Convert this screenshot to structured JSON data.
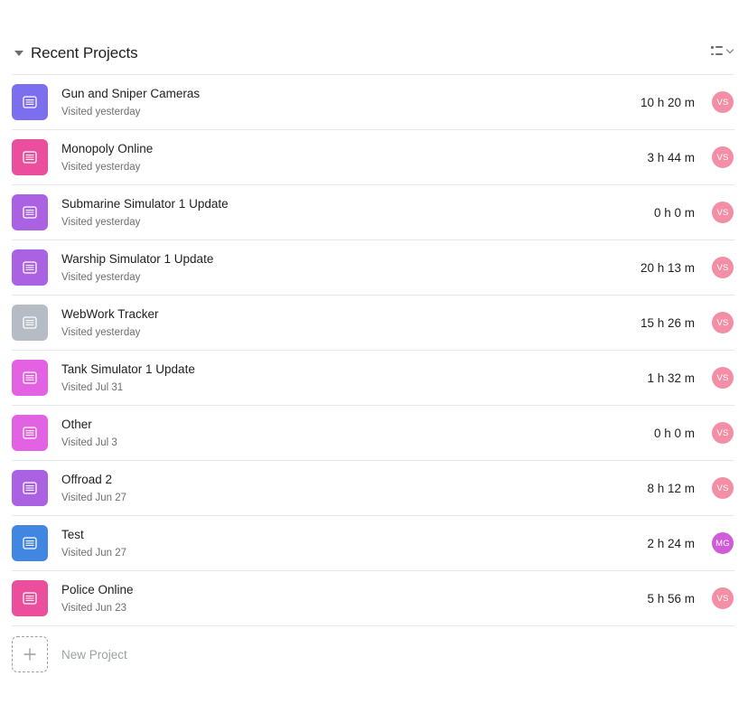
{
  "header": {
    "title": "Recent Projects",
    "collapse_icon": "caret-down-icon",
    "view_icon": "list-view-icon"
  },
  "colors": {
    "avatar_vs": "#f28fa6",
    "avatar_mg": "#d15cd9"
  },
  "projects": [
    {
      "name": "Gun and Sniper Cameras",
      "visited": "Visited yesterday",
      "time": "10 h 20 m",
      "avatar": "VS",
      "color": "#7b6ff0",
      "avatar_color": "#f28fa6"
    },
    {
      "name": "Monopoly Online",
      "visited": "Visited yesterday",
      "time": "3 h 44 m",
      "avatar": "VS",
      "color": "#ea4e9d",
      "avatar_color": "#f28fa6"
    },
    {
      "name": "Submarine Simulator 1 Update",
      "visited": "Visited yesterday",
      "time": "0 h 0 m",
      "avatar": "VS",
      "color": "#aa62e3",
      "avatar_color": "#f28fa6"
    },
    {
      "name": "Warship Simulator 1 Update",
      "visited": "Visited yesterday",
      "time": "20 h 13 m",
      "avatar": "VS",
      "color": "#aa62e3",
      "avatar_color": "#f28fa6"
    },
    {
      "name": "WebWork Tracker",
      "visited": "Visited yesterday",
      "time": "15 h 26 m",
      "avatar": "VS",
      "color": "#b5bcc4",
      "avatar_color": "#f28fa6"
    },
    {
      "name": "Tank Simulator 1 Update",
      "visited": "Visited Jul 31",
      "time": "1 h 32 m",
      "avatar": "VS",
      "color": "#e362e3",
      "avatar_color": "#f28fa6"
    },
    {
      "name": "Other",
      "visited": "Visited Jul 3",
      "time": "0 h 0 m",
      "avatar": "VS",
      "color": "#e362e3",
      "avatar_color": "#f28fa6"
    },
    {
      "name": "Offroad 2",
      "visited": "Visited Jun 27",
      "time": "8 h 12 m",
      "avatar": "VS",
      "color": "#aa62e3",
      "avatar_color": "#f28fa6"
    },
    {
      "name": "Test",
      "visited": "Visited Jun 27",
      "time": "2 h 24 m",
      "avatar": "MG",
      "color": "#4186e0",
      "avatar_color": "#d15cd9"
    },
    {
      "name": "Police Online",
      "visited": "Visited Jun 23",
      "time": "5 h 56 m",
      "avatar": "VS",
      "color": "#ea4e9d",
      "avatar_color": "#f28fa6"
    }
  ],
  "new_project": {
    "label": "New Project",
    "icon": "plus-icon"
  }
}
